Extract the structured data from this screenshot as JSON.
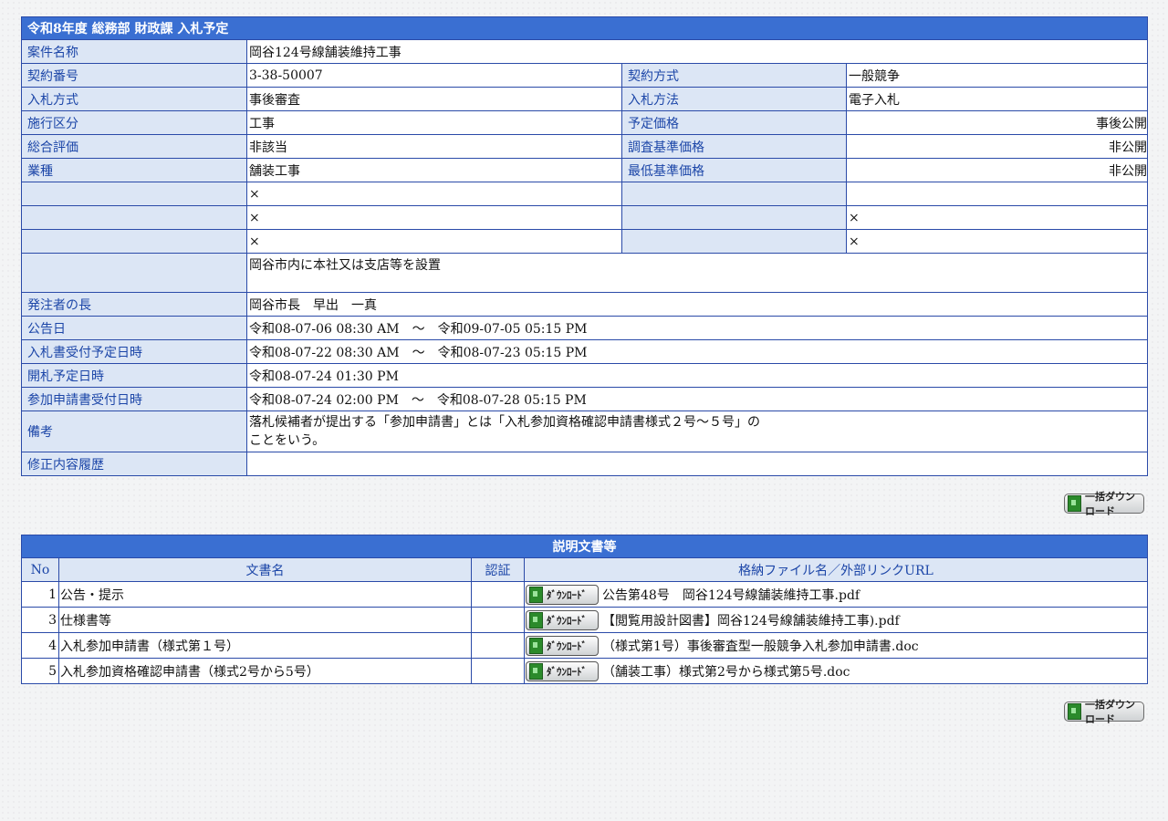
{
  "header": {
    "title": "令和8年度 総務部 財政課 入札予定"
  },
  "project": {
    "label": "案件名称",
    "value": "岡谷124号線舗装維持工事"
  },
  "rows": [
    {
      "l1": "契約番号",
      "v1": "3-38-50007",
      "l2": "契約方式",
      "v2": "一般競争"
    },
    {
      "l1": "入札方式",
      "v1": "事後審査",
      "l2": "入札方法",
      "v2": "電子入札"
    },
    {
      "l1": "施行区分",
      "v1": "工事",
      "l2": "予定価格",
      "v2": "事後公開"
    },
    {
      "l1": "総合評価",
      "v1": "非該当",
      "l2": "調査基準価格",
      "v2": "非公開"
    },
    {
      "l1": "業種",
      "v1": "舗装工事",
      "l2": "最低基準価格",
      "v2": "非公開"
    },
    {
      "l1": "",
      "v1": "×",
      "l2": "",
      "v2": ""
    },
    {
      "l1": "",
      "v1": "×",
      "l2": "",
      "v2": "×"
    },
    {
      "l1": "",
      "v1": "×",
      "l2": "",
      "v2": "×"
    }
  ],
  "condition": {
    "label": "",
    "value": "岡谷市内に本社又は支店等を設置"
  },
  "details": [
    {
      "label": "発注者の長",
      "value": "岡谷市長　早出　一真"
    },
    {
      "label": "公告日",
      "value": "令和08-07-06 08:30 AM　～　令和09-07-05 05:15 PM"
    },
    {
      "label": "入札書受付予定日時",
      "value": "令和08-07-22 08:30 AM　～　令和08-07-23 05:15 PM"
    },
    {
      "label": "開札予定日時",
      "value": "令和08-07-24 01:30 PM"
    },
    {
      "label": "参加申請書受付日時",
      "value": "令和08-07-24 02:00 PM　～　令和08-07-28 05:15 PM"
    }
  ],
  "remarks": {
    "label": "備考",
    "line1": "落札候補者が提出する「参加申請書」とは「入札参加資格確認申請書様式２号～５号」の",
    "line2": "ことをいう。"
  },
  "history": {
    "label": "修正内容履歴",
    "value": ""
  },
  "bulk_download": {
    "label": "一括ダウンロード"
  },
  "documents": {
    "title": "説明文書等",
    "columns": {
      "no": "No",
      "name": "文書名",
      "cert": "認証",
      "file": "格納ファイル名／外部リンクURL"
    },
    "download_label": "ﾀﾞｳﾝﾛｰﾄﾞ",
    "items": [
      {
        "no": "1",
        "name": "公告・提示",
        "cert": "",
        "file": "公告第48号　岡谷124号線舗装維持工事.pdf"
      },
      {
        "no": "3",
        "name": "仕様書等",
        "cert": "",
        "file": "【閲覧用設計図書】岡谷124号線舗装維持工事).pdf"
      },
      {
        "no": "4",
        "name": "入札参加申請書（様式第１号）",
        "cert": "",
        "file": "（様式第1号）事後審査型一般競争入札参加申請書.doc"
      },
      {
        "no": "5",
        "name": "入札参加資格確認申請書（様式2号から5号）",
        "cert": "",
        "file": "（舗装工事）様式第2号から様式第5号.doc"
      }
    ]
  }
}
